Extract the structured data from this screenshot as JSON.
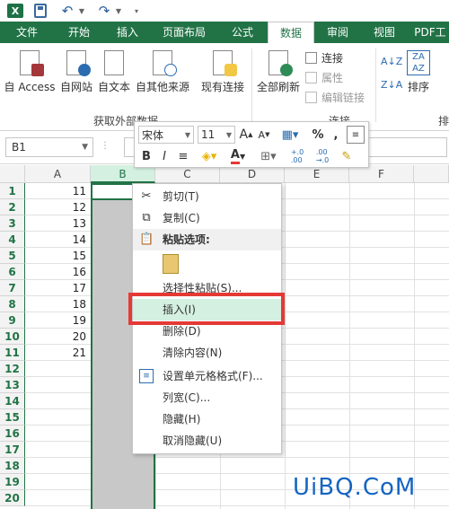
{
  "ribbon_tabs": [
    "文件",
    "开始",
    "插入",
    "页面布局",
    "公式",
    "数据",
    "审阅",
    "视图",
    "PDF工"
  ],
  "active_tab": "数据",
  "external_data_group": {
    "buttons": [
      "自 Access",
      "自网站",
      "自文本",
      "自其他来源",
      "现有连接"
    ],
    "label": "获取外部数据"
  },
  "connections_group": {
    "refresh_all": "全部刷新",
    "connections": "连接",
    "properties": "属性",
    "edit_links": "编辑链接",
    "label": "连接"
  },
  "sort_group": {
    "sort": "排序",
    "label": "排"
  },
  "name_box": "B1",
  "mini_toolbar": {
    "font_name": "宋体",
    "font_size": "11",
    "grow": "A",
    "shrink": "A",
    "percent": "%",
    "comma": ",",
    "bold": "B",
    "italic": "I",
    "font_color_letter": "A",
    "inc_decimal": "+.0\n.00",
    "dec_decimal": ".00\n→.0"
  },
  "columns": [
    "A",
    "B",
    "C",
    "D",
    "E",
    "F"
  ],
  "rows": [
    "1",
    "2",
    "3",
    "4",
    "5",
    "6",
    "7",
    "8",
    "9",
    "10",
    "11",
    "12",
    "13",
    "14",
    "15",
    "16",
    "17",
    "18",
    "19",
    "20"
  ],
  "column_a_values": [
    "11",
    "12",
    "13",
    "14",
    "15",
    "16",
    "17",
    "18",
    "19",
    "20",
    "21"
  ],
  "context_menu": {
    "cut": "剪切(T)",
    "copy": "复制(C)",
    "paste_options": "粘贴选项:",
    "paste_special": "选择性粘贴(S)...",
    "insert": "插入(I)",
    "delete": "删除(D)",
    "clear": "清除内容(N)",
    "format_cells": "设置单元格格式(F)...",
    "column_width": "列宽(C)...",
    "hide": "隐藏(H)",
    "unhide": "取消隐藏(U)"
  },
  "watermark": "UiBQ.CoM",
  "colors": {
    "brand_green": "#217346",
    "selection_gray": "#c8c8c8",
    "highlight_red": "#e53935",
    "watermark_blue": "#1565c0"
  }
}
